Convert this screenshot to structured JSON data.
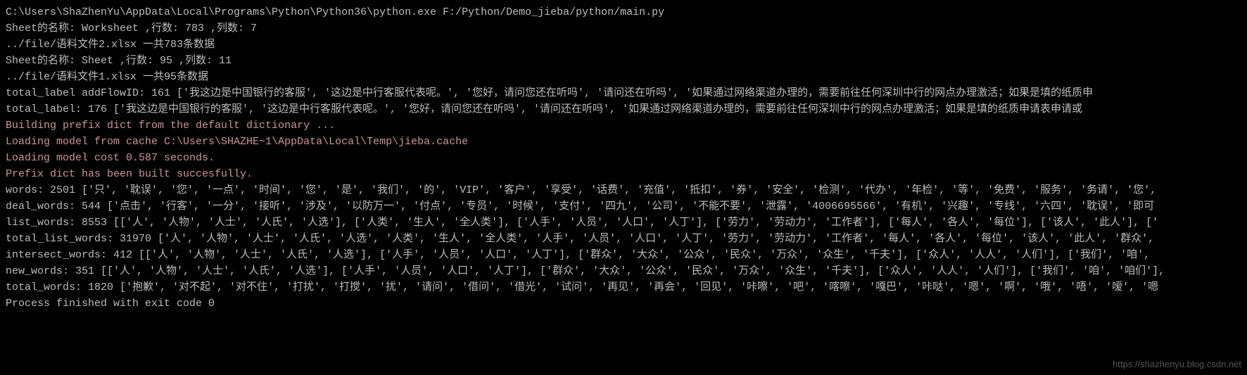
{
  "lines": [
    {
      "text": "C:\\Users\\ShaZhenYu\\AppData\\Local\\Programs\\Python\\Python36\\python.exe F:/Python/Demo_jieba/python/main.py",
      "cls": ""
    },
    {
      "text": "Sheet的名称: Worksheet ,行数: 783 ,列数: 7",
      "cls": ""
    },
    {
      "text": "../file/语料文件2.xlsx 一共783条数据",
      "cls": ""
    },
    {
      "text": "Sheet的名称: Sheet ,行数: 95 ,列数: 11",
      "cls": ""
    },
    {
      "text": "../file/语料文件1.xlsx 一共95条数据",
      "cls": ""
    },
    {
      "text": "total_label addFlowID: 161 ['我这边是中国银行的客服', '这边是中行客服代表呢。', '您好，请问您还在听吗', '请问还在听吗', '如果通过网络渠道办理的，需要前往任何深圳中行的网点办理激活；如果是填的纸质申",
      "cls": ""
    },
    {
      "text": "total_label: 176 ['我这边是中国银行的客服', '这边是中行客服代表呢。', '您好，请问您还在听吗', '请问还在听吗', '如果通过网络渠道办理的，需要前往任何深圳中行的网点办理激活；如果是填的纸质申请表申请或",
      "cls": ""
    },
    {
      "text": "Building prefix dict from the default dictionary ...",
      "cls": "pink"
    },
    {
      "text": "Loading model from cache C:\\Users\\SHAZHE~1\\AppData\\Local\\Temp\\jieba.cache",
      "cls": "pink"
    },
    {
      "text": "Loading model cost 0.587 seconds.",
      "cls": "pink"
    },
    {
      "text": "Prefix dict has been built succesfully.",
      "cls": "pink"
    },
    {
      "text": "words: 2501 ['只', '耽误', '您', '一点', '时间', '您', '是', '我们', '的', 'VIP', '客户', '享受', '话费', '充值', '抵扣', '券', '安全', '检测', '代办', '年检', '等', '免费', '服务', '务请', '您',",
      "cls": ""
    },
    {
      "text": "deal_words: 544 ['点击', '行客', '一分', '接听', '涉及', '以防万一', '付点', '专员', '时候', '支付', '四九', '公司', '不能不要', '泄露', '4006695566', '有机', '兴趣', '专线', '六四', '耽误', '即可",
      "cls": ""
    },
    {
      "text": "list_words: 8553 [['人', '人物', '人士', '人氏', '人选'], ['人类', '生人', '全人类'], ['人手', '人员', '人口', '人丁'], ['劳力', '劳动力', '工作者'], ['每人', '各人', '每位'], ['该人', '此人'], ['",
      "cls": ""
    },
    {
      "text": "total_list_words: 31970 ['人', '人物', '人士', '人氏', '人选', '人类', '生人', '全人类', '人手', '人员', '人口', '人丁', '劳力', '劳动力', '工作者', '每人', '各人', '每位', '该人', '此人', '群众',",
      "cls": ""
    },
    {
      "text": "intersect_words: 412 [['人', '人物', '人士', '人氏', '人选'], ['人手', '人员', '人口', '人丁'], ['群众', '大众', '公众', '民众', '万众', '众生', '千夫'], ['众人', '人人', '人们'], ['我们', '咱',",
      "cls": ""
    },
    {
      "text": "new_words: 351 [['人', '人物', '人士', '人氏', '人选'], ['人手', '人员', '人口', '人丁'], ['群众', '大众', '公众', '民众', '万众', '众生', '千夫'], ['众人', '人人', '人们'], ['我们', '咱', '咱们'],",
      "cls": ""
    },
    {
      "text": "total_words: 1820 ['抱歉', '对不起', '对不住', '打扰', '打搅', '扰', '请问', '借问', '借光', '试问', '再见', '再会', '回见', '咔嚓', '吧', '喀嚓', '嘎巴', '咔哒', '嗯', '啊', '哦', '唔', '嗳', '嗯",
      "cls": ""
    },
    {
      "text": "",
      "cls": ""
    },
    {
      "text": "Process finished with exit code 0",
      "cls": ""
    }
  ],
  "watermark": "https://shazhenyu.blog.csdn.net"
}
